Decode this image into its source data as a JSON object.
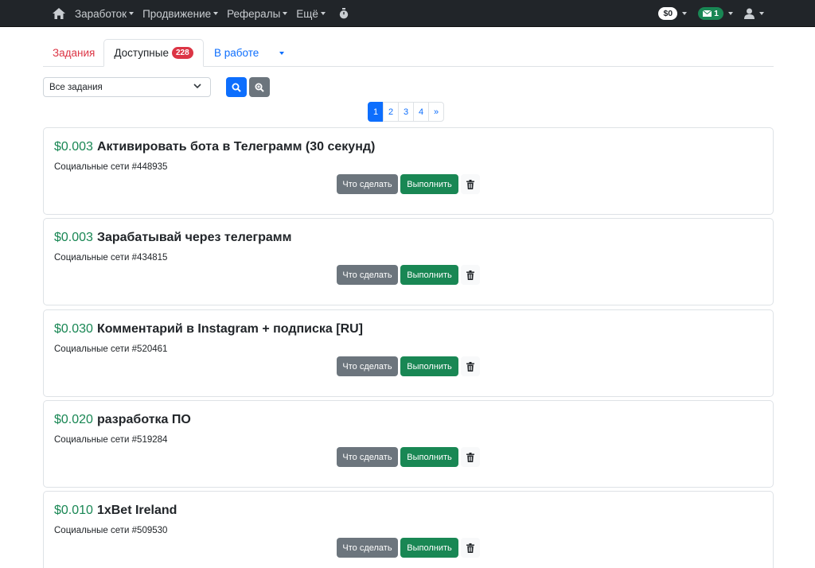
{
  "navbar": {
    "items": [
      {
        "label": "Заработок"
      },
      {
        "label": "Продвижение"
      },
      {
        "label": "Рефералы"
      },
      {
        "label": "Ещё"
      }
    ],
    "balance": "$0",
    "messages_count": "1"
  },
  "tabs": {
    "tasks": "Задания",
    "available": "Доступные",
    "available_count": "228",
    "in_work": "В работе"
  },
  "filter": {
    "selected": "Все задания"
  },
  "pagination": {
    "pages": [
      "1",
      "2",
      "3",
      "4",
      "»"
    ],
    "active": "1"
  },
  "buttons": {
    "what_to_do": "Что сделать",
    "execute": "Выполнить"
  },
  "tasks": [
    {
      "price": "$0.003",
      "title": "Активировать бота в Телеграмм (30 секунд)",
      "category": "Социальные сети #448935"
    },
    {
      "price": "$0.003",
      "title": "Зарабатывай через телеграмм",
      "category": "Социальные сети #434815"
    },
    {
      "price": "$0.030",
      "title": "Комментарий в Instagram + подписка [RU]",
      "category": "Социальные сети #520461"
    },
    {
      "price": "$0.020",
      "title": "разработка ПО",
      "category": "Социальные сети #519284"
    },
    {
      "price": "$0.010",
      "title": "1xBet Ireland",
      "category": "Социальные сети #509530"
    }
  ],
  "colors": {
    "navbar": "#212529",
    "primary": "#0d6efd",
    "success": "#198754",
    "danger": "#dc3545",
    "secondary": "#6c757d"
  }
}
